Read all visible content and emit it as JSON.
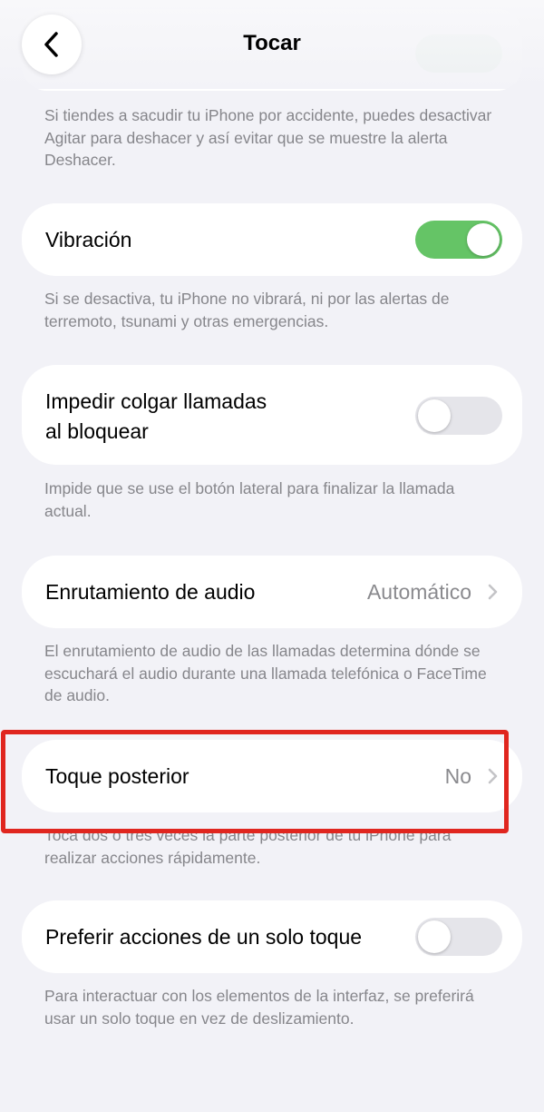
{
  "header": {
    "title": "Tocar",
    "back_icon": "chevron-left-icon",
    "hidden_row_label": "Agitar para deshacer"
  },
  "shake_undo": {
    "footnote": "Si tiendes a sacudir tu iPhone por accidente, puedes desactivar Agitar para deshacer y así evitar que se muestre la alerta Deshacer.",
    "toggle_on": true
  },
  "vibration": {
    "label": "Vibración",
    "toggle_on": true,
    "footnote": "Si se desactiva, tu iPhone no vibrará, ni por las alertas de terremoto, tsunami y otras emergencias."
  },
  "prevent_lock_end_call": {
    "label_line1": "Impedir colgar llamadas",
    "label_line2": "al bloquear",
    "toggle_on": false,
    "footnote": "Impide que se use el botón lateral para finalizar la llamada actual."
  },
  "audio_routing": {
    "label": "Enrutamiento de audio",
    "value": "Automático",
    "footnote": "El enrutamiento de audio de las llamadas determina dónde se escuchará el audio durante una llamada telefónica o FaceTime de audio."
  },
  "back_tap": {
    "label": "Toque posterior",
    "value": "No",
    "footnote": "Toca dos o tres veces la parte posterior de tu iPhone para realizar acciones rápidamente."
  },
  "single_touch": {
    "label": "Preferir acciones de un solo toque",
    "toggle_on": false,
    "footnote": "Para interactuar con los elementos de la interfaz, se preferirá usar un solo toque en vez de deslizamiento."
  },
  "colors": {
    "toggle_on": "#65c466",
    "toggle_off": "#e5e5ea",
    "highlight": "#e0261f",
    "background": "#f2f2f7"
  }
}
